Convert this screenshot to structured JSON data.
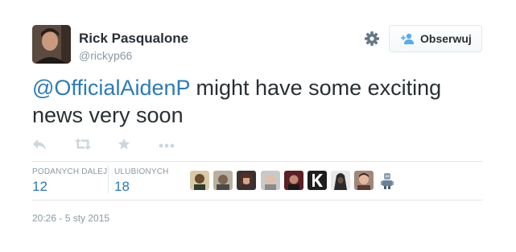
{
  "author": {
    "name": "Rick Pasqualone",
    "handle": "@rickyp66"
  },
  "header": {
    "follow_label": "Obserwuj"
  },
  "tweet": {
    "mention": "@OfficialAidenP",
    "text": " might have some exciting news very soon"
  },
  "actions": {
    "icons": [
      "reply-icon",
      "retweet-icon",
      "favorite-icon",
      "more-icon"
    ]
  },
  "stats": {
    "retweets_label": "PODANYCH DALEJ",
    "retweets_count": "12",
    "favorites_label": "ULUBIONYCH",
    "favorites_count": "18"
  },
  "favoriters": {
    "count_shown": 9
  },
  "timestamp": "20:26 - 5 sty 2015",
  "colors": {
    "link": "#2b7bb9",
    "text": "#292f33",
    "muted": "#8899a6",
    "border": "#e1e8ed"
  }
}
